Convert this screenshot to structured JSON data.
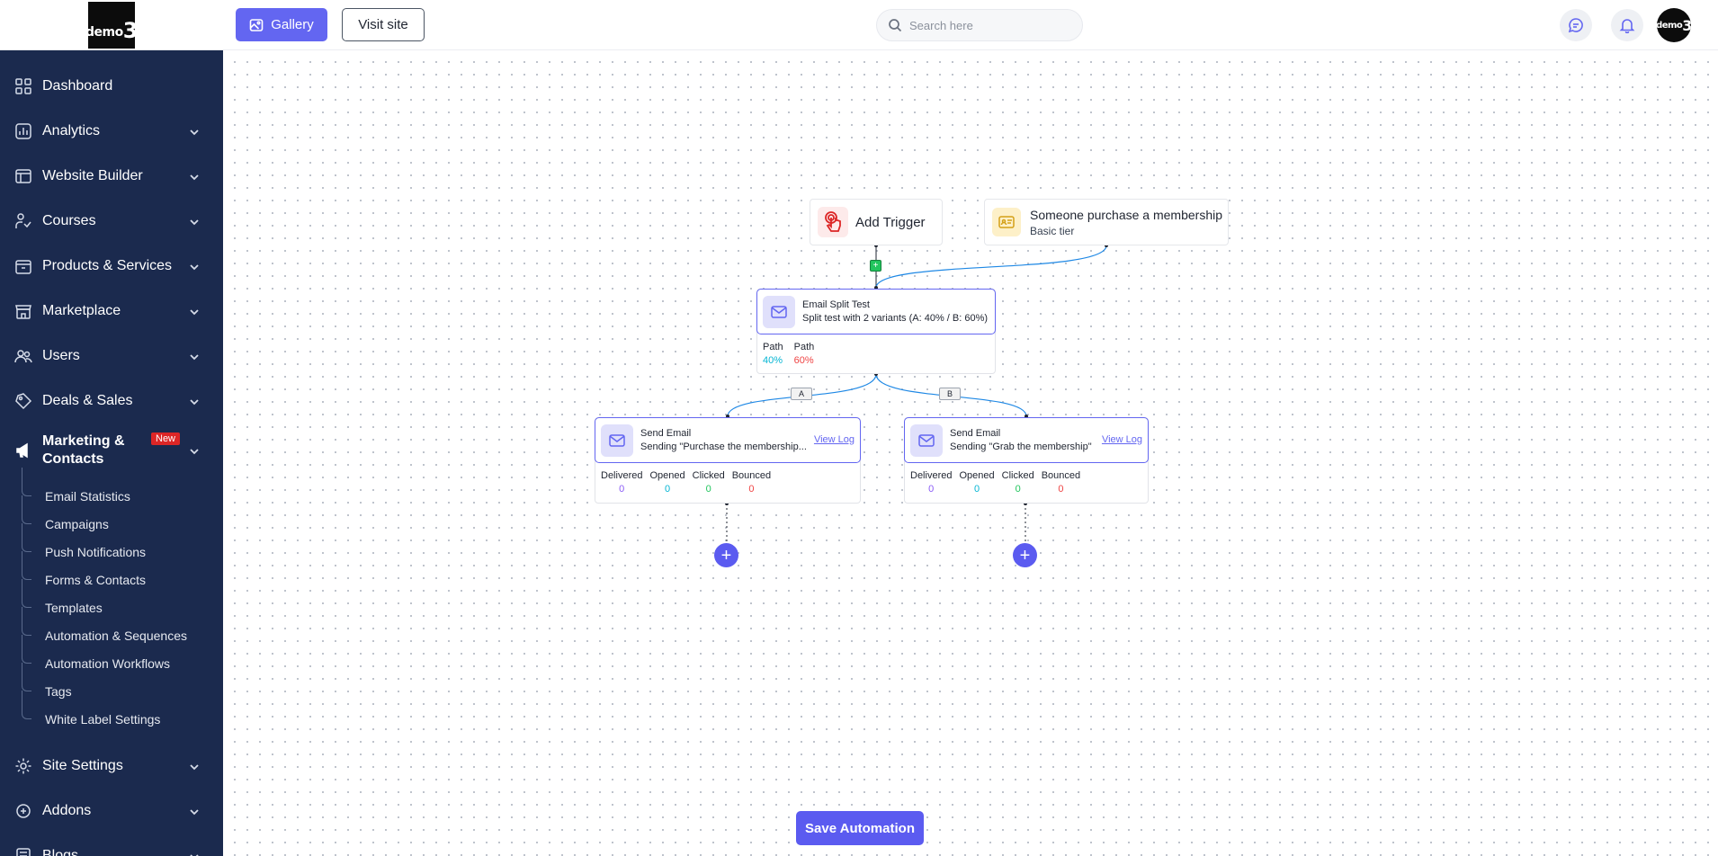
{
  "brand": {
    "logo_small": "demo",
    "logo_big": "3"
  },
  "header": {
    "gallery_label": "Gallery",
    "visit_label": "Visit site",
    "search_placeholder": "Search here"
  },
  "sidebar": {
    "items": [
      {
        "label": "Dashboard",
        "icon": "dashboard-icon"
      },
      {
        "label": "Analytics",
        "icon": "analytics-icon"
      },
      {
        "label": "Website Builder",
        "icon": "website-builder-icon"
      },
      {
        "label": "Courses",
        "icon": "courses-icon"
      },
      {
        "label": "Products & Services",
        "icon": "products-icon"
      },
      {
        "label": "Marketplace",
        "icon": "marketplace-icon"
      },
      {
        "label": "Users",
        "icon": "users-icon"
      },
      {
        "label": "Deals & Sales",
        "icon": "deals-icon"
      }
    ],
    "active": {
      "label": "Marketing & Contacts",
      "badge": "New",
      "icon": "megaphone-icon"
    },
    "sub_items": [
      "Email Statistics",
      "Campaigns",
      "Push Notifications",
      "Forms & Contacts",
      "Templates",
      "Automation & Sequences",
      "Automation Workflows",
      "Tags",
      "White Label Settings"
    ],
    "bottom_items": [
      {
        "label": "Site Settings",
        "icon": "settings-icon"
      },
      {
        "label": "Addons",
        "icon": "addons-icon"
      },
      {
        "label": "Blogs",
        "icon": "blogs-icon"
      }
    ]
  },
  "workflow": {
    "trigger": {
      "label": "Add Trigger"
    },
    "membership": {
      "title": "Someone purchase a membership",
      "subtitle": "Basic tier"
    },
    "split": {
      "title": "Email Split Test",
      "subtitle": "Split test with 2 variants (A: 40% / B: 60%)",
      "path_a": {
        "label": "Path",
        "value": "40%",
        "color": "#06b6d4"
      },
      "path_b": {
        "label": "Path",
        "value": "60%",
        "color": "#ef4444"
      }
    },
    "branch_labels": {
      "a": "A",
      "b": "B"
    },
    "edge_plus": "+",
    "email_a": {
      "title": "Send Email",
      "subtitle": "Sending \"Purchase the membership...",
      "view_log": "View Log",
      "stats": [
        {
          "label": "Delivered",
          "value": "0",
          "color": "#8b5cf6"
        },
        {
          "label": "Opened",
          "value": "0",
          "color": "#06b6d4"
        },
        {
          "label": "Clicked",
          "value": "0",
          "color": "#22c55e"
        },
        {
          "label": "Bounced",
          "value": "0",
          "color": "#ef4444"
        }
      ]
    },
    "email_b": {
      "title": "Send Email",
      "subtitle": "Sending \"Grab the membership\"",
      "view_log": "View Log",
      "stats": [
        {
          "label": "Delivered",
          "value": "0",
          "color": "#8b5cf6"
        },
        {
          "label": "Opened",
          "value": "0",
          "color": "#06b6d4"
        },
        {
          "label": "Clicked",
          "value": "0",
          "color": "#22c55e"
        },
        {
          "label": "Bounced",
          "value": "0",
          "color": "#ef4444"
        }
      ]
    },
    "add_step": "+"
  },
  "save_label": "Save Automation",
  "colors": {
    "sidebar_bg": "#1b2a4e",
    "accent": "#6366f1"
  }
}
